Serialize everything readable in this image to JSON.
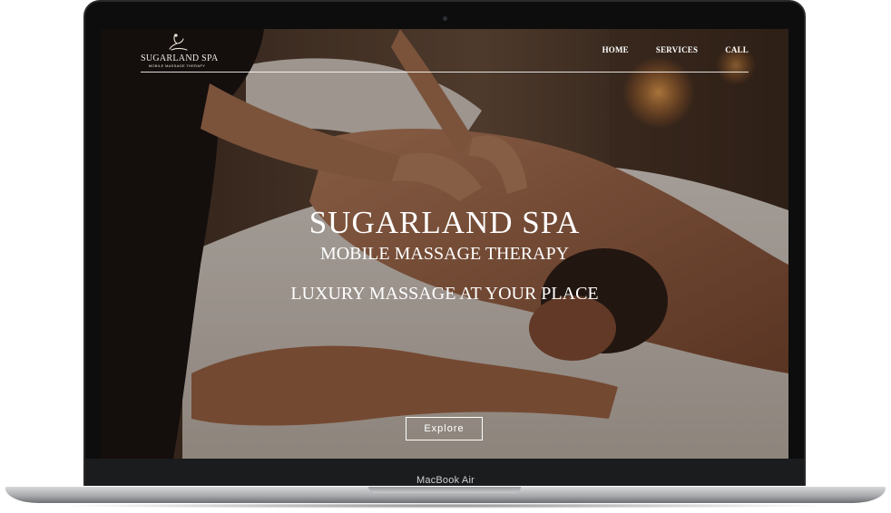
{
  "site": {
    "logo": {
      "name": "SUGARLAND SPA",
      "tagline": "MOBILE MASSAGE THERAPY"
    },
    "nav": [
      {
        "label": "HOME"
      },
      {
        "label": "SERVICES"
      },
      {
        "label": "CALL"
      }
    ],
    "hero": {
      "title": "SUGARLAND SPA",
      "subtitle": "MOBILE MASSAGE THERAPY",
      "tagline": "LUXURY MASSAGE AT YOUR PLACE",
      "cta_label": "Explore"
    }
  },
  "device": {
    "model_label": "MacBook Air"
  },
  "icons": {
    "logo_mark": "massage-figure-icon",
    "camera": "camera-dot"
  },
  "colors": {
    "text": "#ffffff",
    "overlay": "#140c08",
    "skin_tone": "#b07452",
    "towel": "#e9e2da",
    "bezel": "#0d0d0d"
  }
}
